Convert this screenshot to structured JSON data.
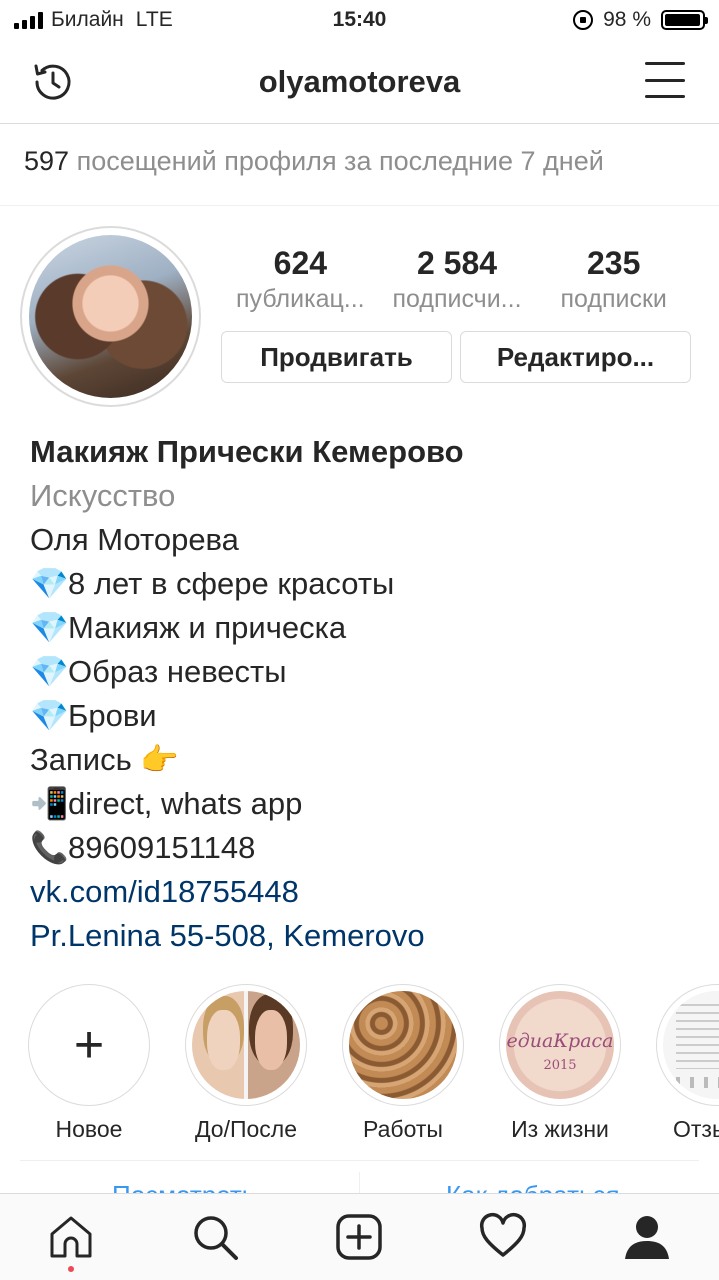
{
  "status_bar": {
    "carrier": "Билайн",
    "network": "LTE",
    "time": "15:40",
    "battery_text": "98 %",
    "battery_level": 0.98
  },
  "header": {
    "username": "olyamotoreva",
    "history_icon": "history-icon",
    "menu_icon": "menu-icon"
  },
  "insights": {
    "visits_count": "597",
    "visits_text": "посещений профиля за последние 7 дней"
  },
  "profile": {
    "stats": [
      {
        "value": "624",
        "label": "публикац..."
      },
      {
        "value": "2 584",
        "label": "подписчи..."
      },
      {
        "value": "235",
        "label": "подписки"
      }
    ],
    "promote_label": "Продвигать",
    "edit_label": "Редактиро..."
  },
  "bio": {
    "name": "Макияж Прически Кемерово",
    "category": "Искусство",
    "lines": [
      {
        "emoji": "",
        "text": "Оля Моторева"
      },
      {
        "emoji": "💎",
        "text": "8 лет в сфере красоты"
      },
      {
        "emoji": "💎",
        "text": "Макияж и прическа"
      },
      {
        "emoji": "💎",
        "text": "Образ невесты"
      },
      {
        "emoji": "💎",
        "text": "Брови"
      },
      {
        "emoji": "👉",
        "text": "Запись"
      },
      {
        "emoji": "📲",
        "text": "direct, whats app"
      },
      {
        "emoji": "📞",
        "text": "89609151148"
      }
    ],
    "links": [
      "vk.com/id18755448",
      "Pr.Lenina 55-508, Kemerovo"
    ]
  },
  "highlights": [
    {
      "label": "Новое",
      "icon": "plus-icon"
    },
    {
      "label": "До/После"
    },
    {
      "label": "Работы"
    },
    {
      "label": "Из жизни",
      "overlay_text": "едиаКраса",
      "overlay_sub": "2015"
    },
    {
      "label": "Отзывы"
    }
  ],
  "partial_actions": [
    "Посмотреть",
    "Как добраться"
  ],
  "tabbar": {
    "items": [
      "home-icon",
      "search-icon",
      "add-icon",
      "heart-icon",
      "profile-icon"
    ],
    "accent": "#ed4956"
  }
}
